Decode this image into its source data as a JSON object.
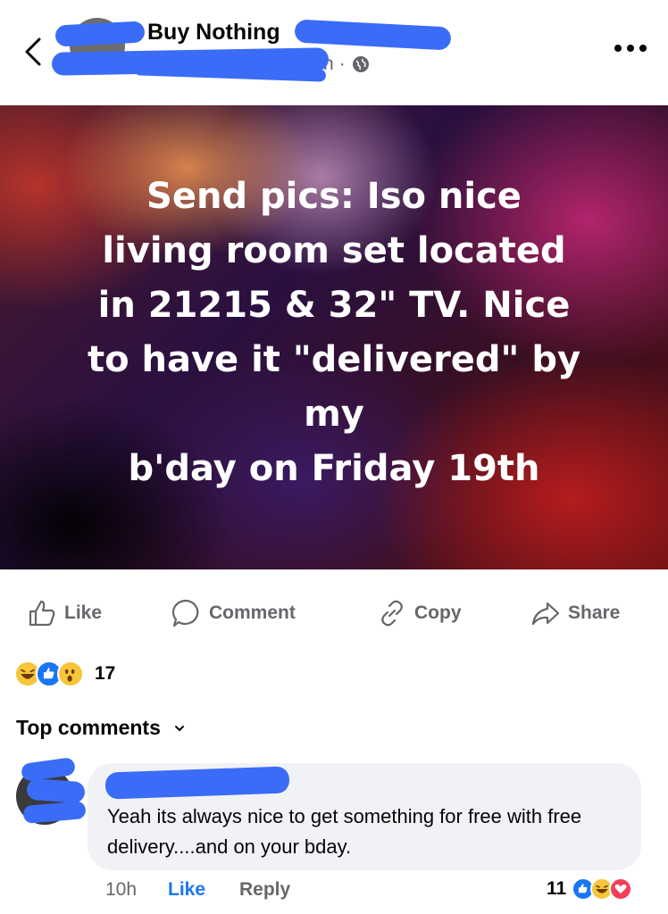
{
  "header": {
    "group_name": "Buy Nothing",
    "time": "h",
    "separator": "·"
  },
  "post": {
    "image_text": "Send pics: Iso nice\nliving room set located\nin 21215 & 32\" TV. Nice\nto have it \"delivered\" by\nmy\nb'day on Friday 19th"
  },
  "actions": {
    "like": "Like",
    "comment": "Comment",
    "copy": "Copy",
    "share": "Share"
  },
  "reactions": {
    "icons": [
      "haha-icon",
      "like-icon",
      "wow-icon"
    ],
    "count": "17"
  },
  "comments_section": {
    "title": "Top comments"
  },
  "comment": {
    "text": "Yeah its always nice to get something for free with free delivery....and on your bday.",
    "time": "10h",
    "like": "Like",
    "reply": "Reply",
    "reaction_count": "11",
    "reaction_icons": [
      "like-icon",
      "haha-icon",
      "love-icon"
    ]
  },
  "colors": {
    "accent": "#1877f2",
    "redaction": "#3b6cf7",
    "muted_text": "#65676b",
    "bubble": "#f0f2f5"
  }
}
